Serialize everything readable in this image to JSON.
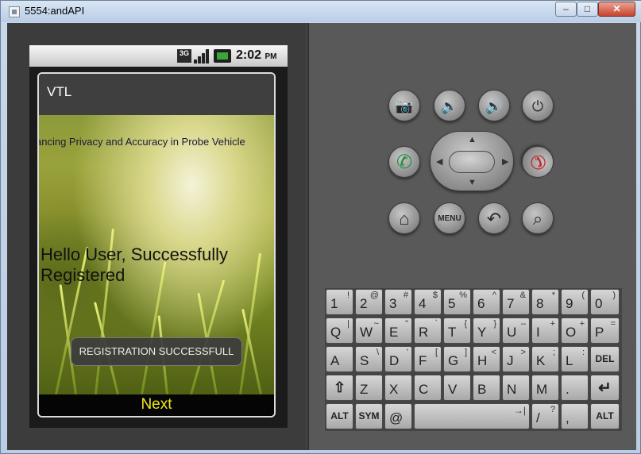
{
  "window": {
    "title": "5554:andAPI",
    "min_glyph": "–",
    "max_glyph": "□",
    "close_glyph": "✕"
  },
  "status_bar": {
    "network": "3G",
    "time": "2:02",
    "ampm": "PM"
  },
  "app": {
    "title": "VTL",
    "marquee_text": "ancing Privacy and Accuracy in Probe Vehicle",
    "message": "Hello User, Successfully Registered",
    "toast": "REGISTRATION SUCCESSFULL",
    "next_label": "Next"
  },
  "controls": {
    "row1": [
      {
        "name": "camera-button",
        "icon": "camera-icon",
        "glyph": "📷"
      },
      {
        "name": "volume-down-button",
        "icon": "volume-down-icon",
        "glyph": "🔉"
      },
      {
        "name": "volume-up-button",
        "icon": "volume-up-icon",
        "glyph": "🔊"
      },
      {
        "name": "power-button",
        "icon": "power-icon",
        "glyph": "⏻"
      }
    ],
    "call_glyph": "✆",
    "endcall_glyph": "✆",
    "menu_label": "MENU",
    "home_glyph": "⌂",
    "back_glyph": "↶",
    "search_glyph": "⌕",
    "colors": {
      "call": "#1f8f3a",
      "end_call": "#c4222a"
    }
  },
  "keyboard": {
    "row1": [
      [
        "1",
        "!"
      ],
      [
        "2",
        "@"
      ],
      [
        "3",
        "#"
      ],
      [
        "4",
        "$"
      ],
      [
        "5",
        "%"
      ],
      [
        "6",
        "^"
      ],
      [
        "7",
        "&"
      ],
      [
        "8",
        "*"
      ],
      [
        "9",
        "("
      ],
      [
        "0",
        ")"
      ]
    ],
    "row2": [
      [
        "Q",
        "|"
      ],
      [
        "W",
        "~"
      ],
      [
        "E",
        "\""
      ],
      [
        "R",
        "`"
      ],
      [
        "T",
        "{"
      ],
      [
        "Y",
        "}"
      ],
      [
        "U",
        "–"
      ],
      [
        "I",
        "+"
      ],
      [
        "O",
        "+"
      ],
      [
        "P",
        "="
      ]
    ],
    "row3": [
      [
        "A",
        ""
      ],
      [
        "S",
        "\\"
      ],
      [
        "D",
        "'"
      ],
      [
        "F",
        "["
      ],
      [
        "G",
        "]"
      ],
      [
        "H",
        "<"
      ],
      [
        "J",
        ">"
      ],
      [
        "K",
        ";"
      ],
      [
        "L",
        ":"
      ]
    ],
    "del_label": "DEL",
    "row4": [
      [
        "Z",
        ""
      ],
      [
        "X",
        ""
      ],
      [
        "C",
        ""
      ],
      [
        "V",
        ""
      ],
      [
        "B",
        ""
      ],
      [
        "N",
        ""
      ],
      [
        "M",
        ""
      ],
      [
        ".",
        ""
      ]
    ],
    "alt_label": "ALT",
    "sym_label": "SYM",
    "at_label": "@",
    "slash_key": [
      "/",
      "?"
    ],
    "comma_key": [
      ",",
      ""
    ],
    "shift_glyph": "⇧",
    "enter_glyph": "↵",
    "tab_glyph": "→|"
  }
}
